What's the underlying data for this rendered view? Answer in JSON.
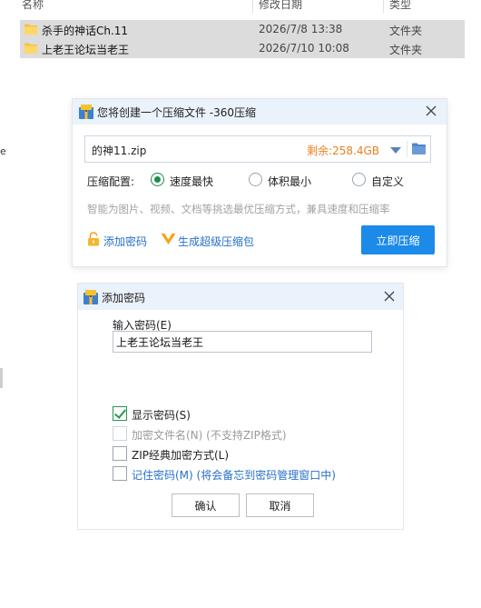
{
  "explorer": {
    "columns": {
      "name": "名称",
      "date": "修改日期",
      "type": "类型"
    },
    "rows": [
      {
        "name": "杀手的神话Ch.11",
        "date": "2026/7/8 13:38",
        "type": "文件夹"
      },
      {
        "name": "上老王论坛当老王",
        "date": "2026/7/10 10:08",
        "type": "文件夹"
      }
    ],
    "left_edge_char": "e"
  },
  "compress_dialog": {
    "title": "您将创建一个压缩文件 -360压缩",
    "filename": "的神11.zip",
    "free_space": "剩余:258.4GB",
    "mode_label": "压缩配置:",
    "modes": [
      "速度最快",
      "体积最小",
      "自定义"
    ],
    "selected_mode": "速度最快",
    "hint": "智能为图片、视频、文档等挑选最优压缩方式，兼具速度和压缩率",
    "add_password_link": "添加密码",
    "super_zip_link": "生成超级压缩包",
    "compress_button": "立即压缩"
  },
  "password_dialog": {
    "title": "添加密码",
    "input_label": "输入密码(E)",
    "password_value": "上老王论坛当老王",
    "options": [
      {
        "label": "显示密码(S)",
        "checked": true,
        "style": "normal"
      },
      {
        "label": "加密文件名(N) (不支持ZIP格式)",
        "checked": false,
        "style": "disabled"
      },
      {
        "label": "ZIP经典加密方式(L)",
        "checked": false,
        "style": "normal"
      },
      {
        "label": "记住密码(M) (将会备忘到密码管理窗口中)",
        "checked": false,
        "style": "link"
      }
    ],
    "ok_button": "确认",
    "cancel_button": "取消"
  },
  "colors": {
    "accent_blue": "#1b8ae8",
    "space_orange": "#e8811f",
    "radio_green": "#1f8c4a",
    "titlebar_bg": "#eaf2fb"
  }
}
